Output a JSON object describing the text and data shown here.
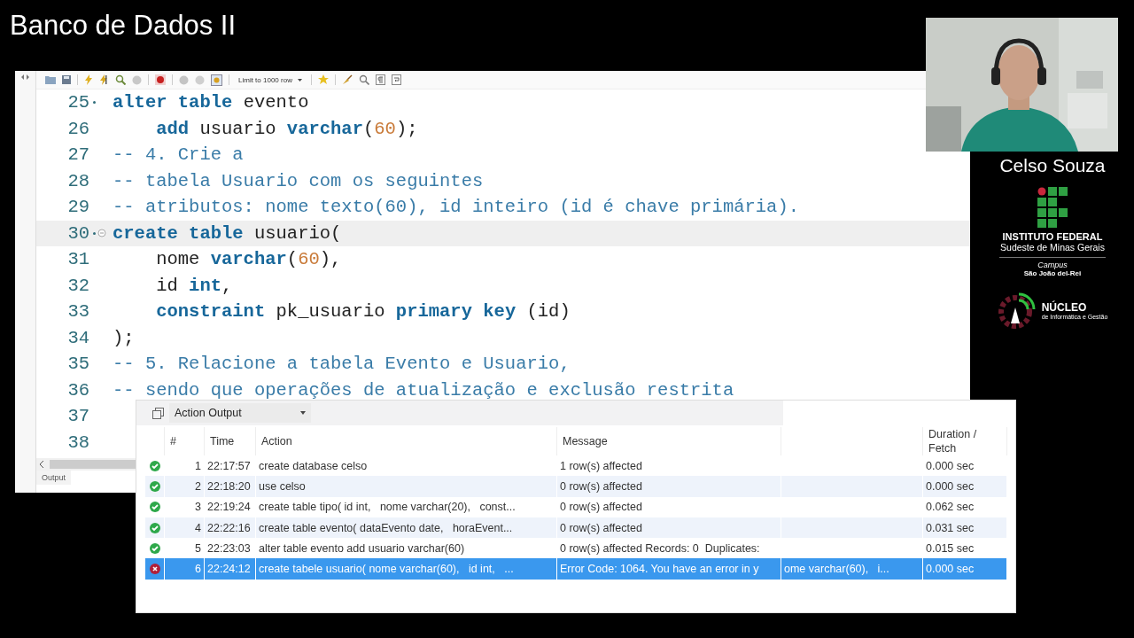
{
  "video_title": "Banco de Dados II",
  "editor": {
    "toolbar": {
      "limit_label": "Limit to 1000 row"
    },
    "lines": [
      {
        "number": "25",
        "marker": true,
        "current": false,
        "fold": false,
        "indent": false,
        "tokens": [
          {
            "kind": "keyword",
            "text": "alter table"
          },
          {
            "kind": "plain",
            "text": " evento"
          }
        ]
      },
      {
        "number": "26",
        "marker": false,
        "current": false,
        "fold": false,
        "indent": true,
        "tokens": [
          {
            "kind": "keyword",
            "text": "add"
          },
          {
            "kind": "plain",
            "text": " usuario "
          },
          {
            "kind": "keyword",
            "text": "varchar"
          },
          {
            "kind": "plain",
            "text": "("
          },
          {
            "kind": "number",
            "text": "60"
          },
          {
            "kind": "plain",
            "text": ");"
          }
        ]
      },
      {
        "number": "27",
        "marker": false,
        "current": false,
        "fold": false,
        "indent": false,
        "tokens": [
          {
            "kind": "comment",
            "text": "-- 4. Crie a"
          }
        ]
      },
      {
        "number": "28",
        "marker": false,
        "current": false,
        "fold": false,
        "indent": false,
        "tokens": [
          {
            "kind": "comment",
            "text": "-- tabela Usuario com os seguintes"
          }
        ]
      },
      {
        "number": "29",
        "marker": false,
        "current": false,
        "fold": false,
        "indent": false,
        "tokens": [
          {
            "kind": "comment",
            "text": "-- atributos: nome texto(60), id inteiro (id é chave primária)."
          }
        ]
      },
      {
        "number": "30",
        "marker": true,
        "current": true,
        "fold": true,
        "indent": false,
        "tokens": [
          {
            "kind": "keyword",
            "text": "create table"
          },
          {
            "kind": "plain",
            "text": " usuario("
          }
        ]
      },
      {
        "number": "31",
        "marker": false,
        "current": false,
        "fold": false,
        "indent": true,
        "tokens": [
          {
            "kind": "plain",
            "text": "nome "
          },
          {
            "kind": "keyword",
            "text": "varchar"
          },
          {
            "kind": "plain",
            "text": "("
          },
          {
            "kind": "number",
            "text": "60"
          },
          {
            "kind": "plain",
            "text": "),"
          }
        ]
      },
      {
        "number": "32",
        "marker": false,
        "current": false,
        "fold": false,
        "indent": true,
        "tokens": [
          {
            "kind": "plain",
            "text": "id "
          },
          {
            "kind": "keyword",
            "text": "int"
          },
          {
            "kind": "plain",
            "text": ","
          }
        ]
      },
      {
        "number": "33",
        "marker": false,
        "current": false,
        "fold": false,
        "indent": true,
        "tokens": [
          {
            "kind": "keyword",
            "text": "constraint"
          },
          {
            "kind": "plain",
            "text": " pk_usuario "
          },
          {
            "kind": "keyword",
            "text": "primary key"
          },
          {
            "kind": "plain",
            "text": " (id)"
          }
        ]
      },
      {
        "number": "34",
        "marker": false,
        "current": false,
        "fold": false,
        "indent": false,
        "tokens": [
          {
            "kind": "plain",
            "text": ");"
          }
        ]
      },
      {
        "number": "35",
        "marker": false,
        "current": false,
        "fold": false,
        "indent": false,
        "tokens": [
          {
            "kind": "comment",
            "text": "-- 5. Relacione a tabela Evento e Usuario,"
          }
        ]
      },
      {
        "number": "36",
        "marker": false,
        "current": false,
        "fold": false,
        "indent": false,
        "tokens": [
          {
            "kind": "comment",
            "text": "-- sendo que operações de atualização e exclusão restrita"
          }
        ]
      },
      {
        "number": "37",
        "marker": false,
        "current": false,
        "fold": false
      },
      {
        "number": "38",
        "marker": false,
        "current": false,
        "fold": false
      }
    ],
    "output_tab": "Output"
  },
  "presenter": {
    "name": "Celso Souza"
  },
  "institution": {
    "name": "INSTITUTO FEDERAL",
    "region": "Sudeste de Minas Gerais",
    "campus_label": "Campus",
    "campus": "São João del-Rei"
  },
  "nucleo": {
    "name": "NÚCLEO",
    "subtitle": "de Informática e Gestão"
  },
  "output": {
    "title": "Action Output",
    "columns": [
      "#",
      "Time",
      "Action",
      "Message",
      "Duration / Fetch"
    ],
    "rows": [
      {
        "failed": false,
        "number": "1",
        "time": "22:17:57",
        "action": "create database celso",
        "message": "1 row(s) affected",
        "duration": "0.000 sec",
        "selected": false
      },
      {
        "failed": false,
        "number": "2",
        "time": "22:18:20",
        "action": "use celso",
        "message": "0 row(s) affected",
        "duration": "0.000 sec",
        "selected": false
      },
      {
        "failed": false,
        "number": "3",
        "time": "22:19:24",
        "action": "create table tipo( id int,   nome varchar(20),   const...",
        "message": "0 row(s) affected",
        "duration": "0.062 sec",
        "selected": false
      },
      {
        "failed": false,
        "number": "4",
        "time": "22:22:16",
        "action": "create table evento( dataEvento date,   horaEvent...",
        "message": "0 row(s) affected",
        "duration": "0.031 sec",
        "selected": false
      },
      {
        "failed": false,
        "number": "5",
        "time": "22:23:03",
        "action": "alter table evento add usuario varchar(60)",
        "message": "0 row(s) affected Records: 0  Duplicates:",
        "duration": "0.015 sec",
        "selected": false
      },
      {
        "failed": true,
        "number": "6",
        "time": "22:24:12",
        "action": "create tabele usuario( nome varchar(60),   id int,   ...",
        "message": "Error Code: 1064. You have an error in y",
        "column_5": "ome varchar(60),   i...",
        "duration": "0.000 sec",
        "selected": true
      }
    ]
  }
}
